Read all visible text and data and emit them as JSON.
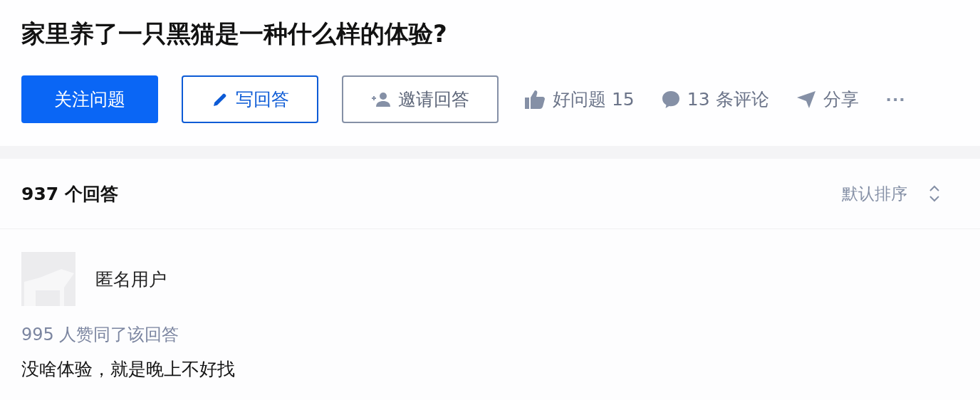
{
  "question": {
    "title": "家里养了一只黑猫是一种什么样的体验?",
    "buttons": [
      {
        "kind": "primary",
        "label": "关注问题"
      },
      {
        "kind": "write",
        "label": "写回答"
      },
      {
        "kind": "invite",
        "label": "邀请回答"
      }
    ],
    "actions": [
      {
        "kind": "like",
        "label": "好问题 15"
      },
      {
        "kind": "comment",
        "label": "13 条评论"
      },
      {
        "kind": "share",
        "label": "分享"
      },
      {
        "kind": "more",
        "label": "···"
      }
    ]
  },
  "answers": {
    "count": "937 个回答",
    "sort": "默认排序",
    "items": [
      {
        "author": "匿名用户",
        "votes": "995 人赞同了该回答",
        "content": "没啥体验，就是晚上不好找"
      }
    ]
  }
}
